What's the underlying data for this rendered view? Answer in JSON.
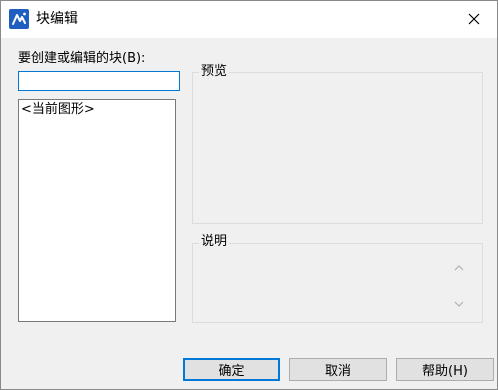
{
  "window": {
    "title": "块编辑"
  },
  "form": {
    "block_label": "要创建或编辑的块(B):",
    "block_input_value": "",
    "list_items": [
      "<当前图形>"
    ]
  },
  "preview": {
    "label": "预览"
  },
  "description": {
    "label": "说明"
  },
  "buttons": {
    "ok": "确定",
    "cancel": "取消",
    "help": "帮助(H)"
  },
  "icons": {
    "app": "app-icon",
    "close": "close-icon",
    "scroll_up": "scroll-up-icon",
    "scroll_down": "scroll-down-icon"
  },
  "colors": {
    "accent": "#0078d7",
    "app_icon": "#1f5fbf"
  }
}
